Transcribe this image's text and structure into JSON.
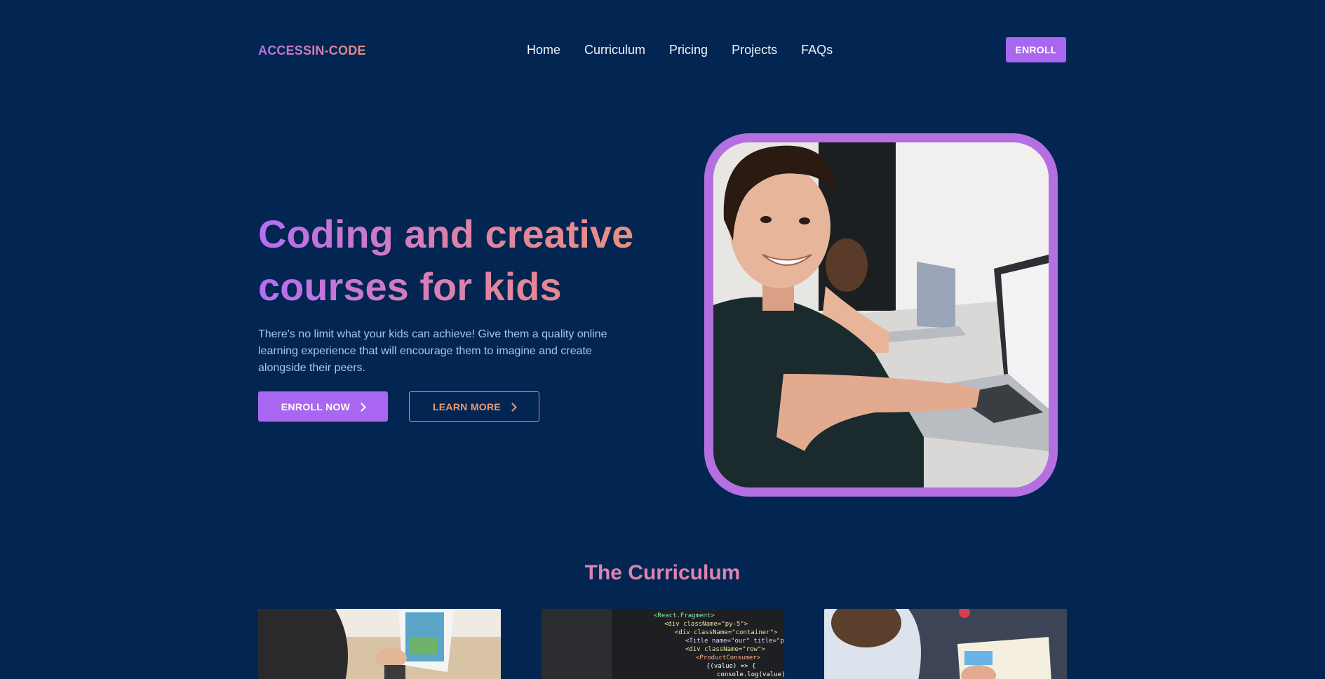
{
  "brand": {
    "name": "ACCESSIN-CODE"
  },
  "nav": {
    "links": [
      "Home",
      "Curriculum",
      "Pricing",
      "Projects",
      "FAQs"
    ],
    "enroll_label": "ENROLL"
  },
  "hero": {
    "title": "Coding and creative courses for kids",
    "description": "There's no limit what your kids can achieve! Give them a quality online learning experience that will encourage them to imagine and create alongside their peers.",
    "primary_button": "ENROLL NOW",
    "secondary_button": "LEARN MORE"
  },
  "curriculum": {
    "title": "The Curriculum"
  },
  "colors": {
    "background": "#022552",
    "accent": "#a967f1",
    "accent_secondary": "#e78f7c",
    "frame": "#b46fe0"
  },
  "icons": {
    "button_arrow": "chevron-right-icon"
  }
}
